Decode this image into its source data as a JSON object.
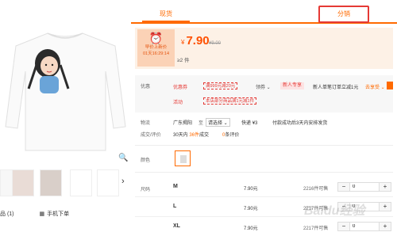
{
  "tabs": {
    "retail": "现货",
    "distribution": "分销"
  },
  "price_panel": {
    "badge_line1": "早价上新价",
    "badge_line2": "01天16:29:14",
    "currency": "¥",
    "price": "7.90",
    "old_price": "¥9.00",
    "moq": "≥2 件"
  },
  "promo": {
    "label": "优惠",
    "coupon_tag": "优惠券",
    "coupon_box": "满999元减20元",
    "coupon_select": "领券",
    "new_user_btn": "新人专享",
    "new_user_text": "新人单笔订单立减1元",
    "more": "去享受",
    "sale_tag": "活动",
    "sale_box": "本店部分商品满1元减1件"
  },
  "logistics": {
    "label": "物流",
    "from": "广东揭阳",
    "to_label": "至",
    "to_select": "请选择",
    "express_label": "快递",
    "express_fee": "¥3",
    "ship_note": "付款成功后3天内安排发货"
  },
  "stats": {
    "label": "成交/评价",
    "period": "30天内",
    "deals": "36件",
    "deals_suffix": "成交",
    "reviews": "0",
    "reviews_suffix": "条评价"
  },
  "color": {
    "label": "颜色"
  },
  "sizes": {
    "label": "尺码",
    "rows": [
      {
        "name": "M",
        "price": "7.90元",
        "stock": "2216件可售",
        "qty": "0"
      },
      {
        "name": "L",
        "price": "7.90元",
        "stock": "2217件可售",
        "qty": "0"
      },
      {
        "name": "XL",
        "price": "7.90元",
        "stock": "2217件可售",
        "qty": "0"
      }
    ]
  },
  "left": {
    "collect_label": "品 (1)",
    "mobile_order": "手机下单"
  },
  "watermark": "Baidu经验",
  "colors": {
    "accent": "#ff6a00",
    "red": "#e53935",
    "panel": "#fdf1e6"
  }
}
